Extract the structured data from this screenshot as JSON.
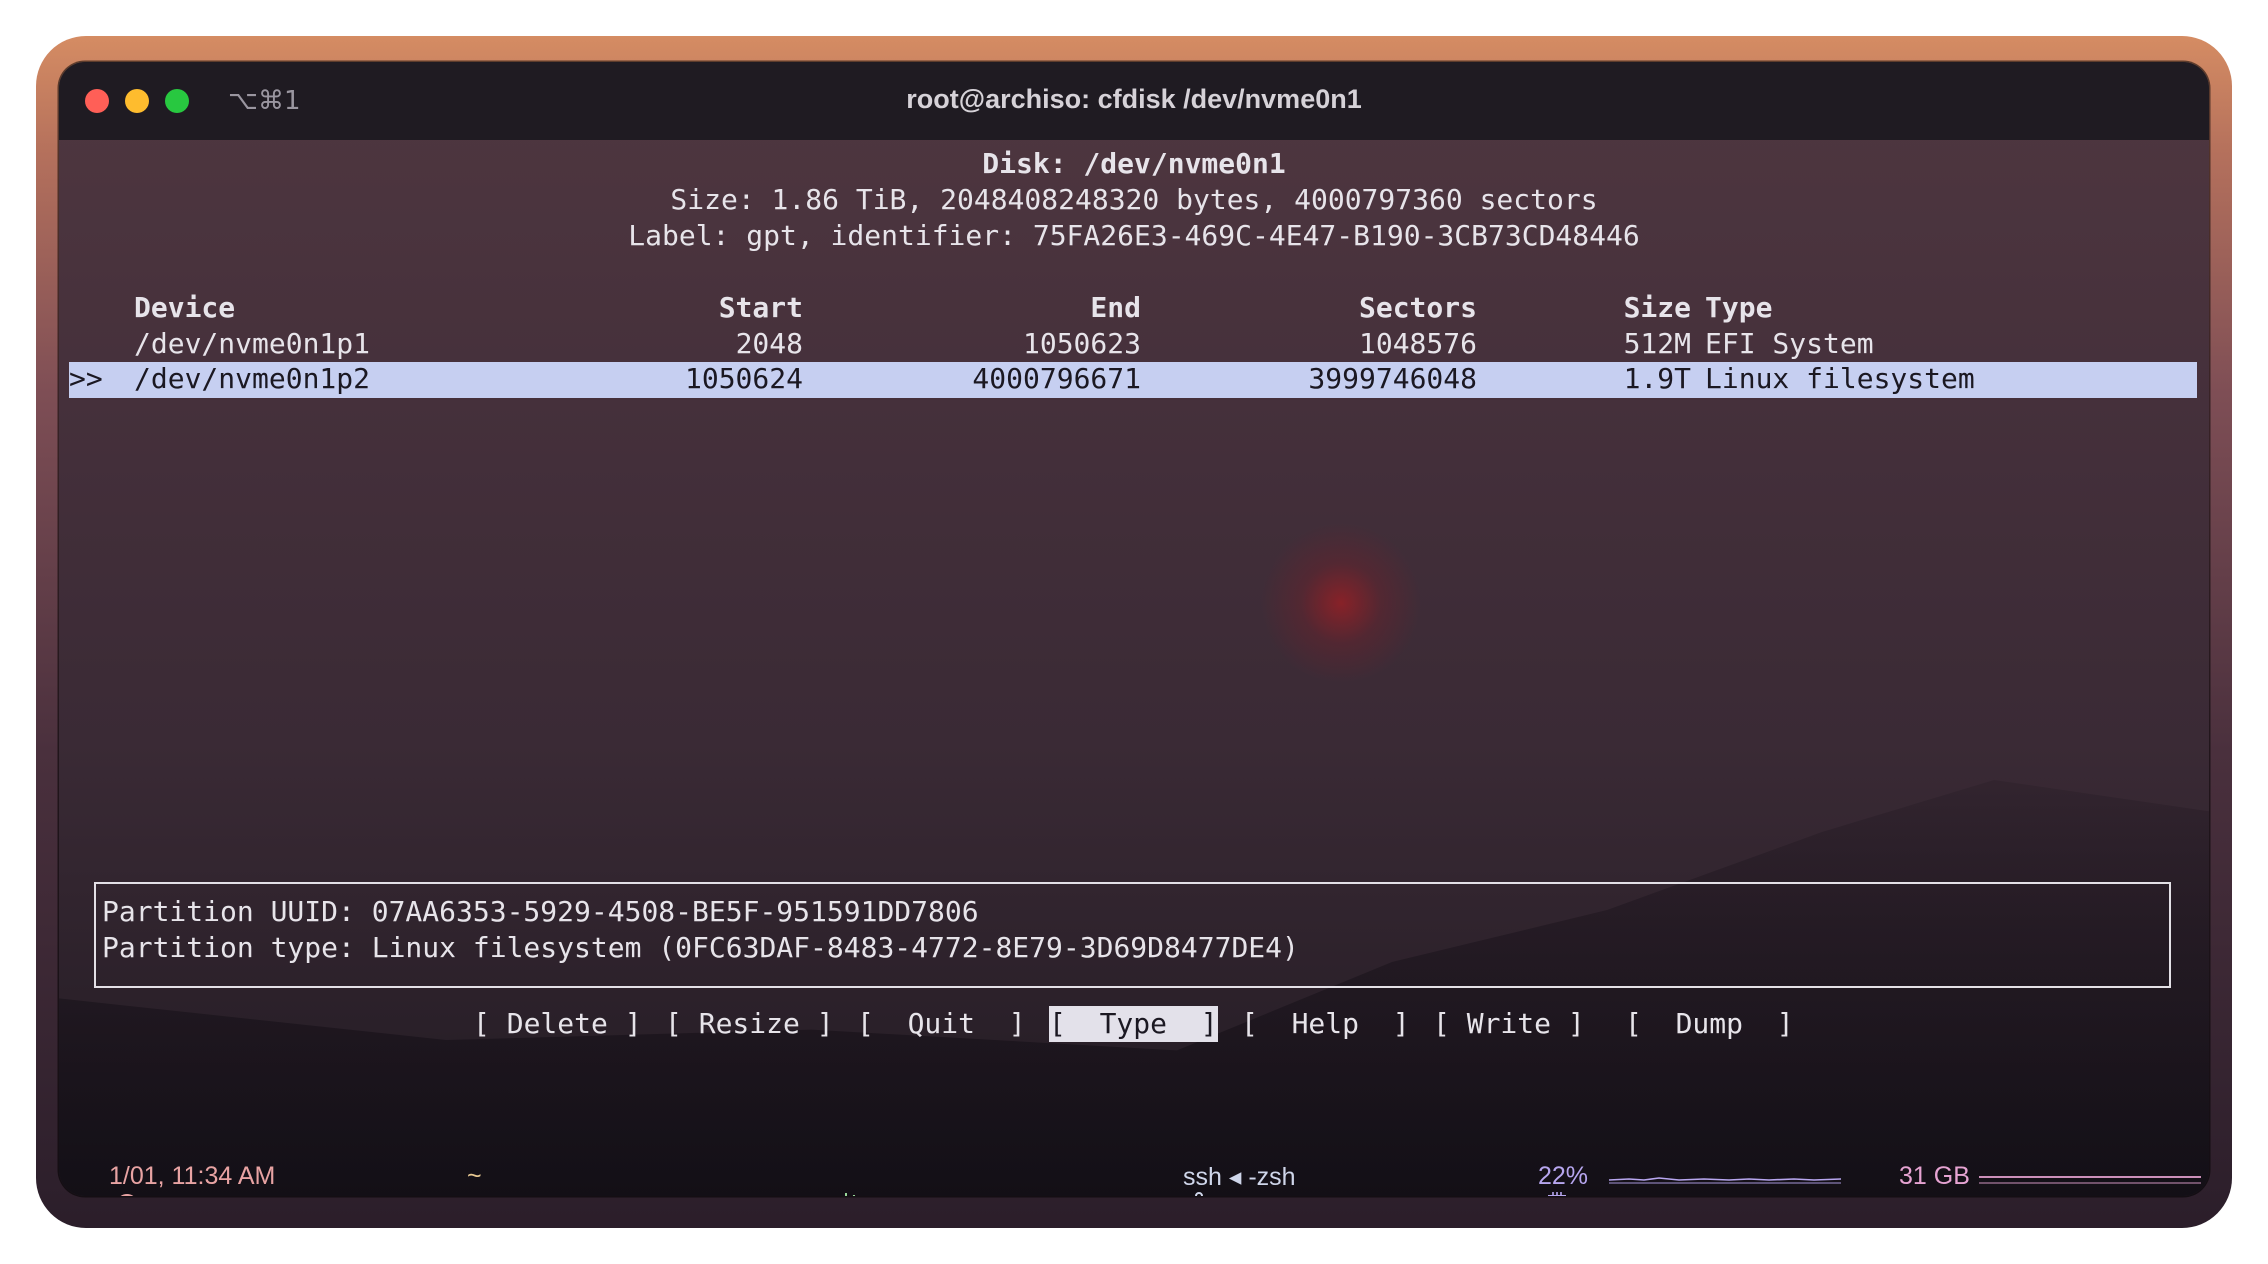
{
  "window": {
    "title": "root@archiso: cfdisk /dev/nvme0n1",
    "shortcut": "⌥⌘1"
  },
  "disk": {
    "header": "Disk: /dev/nvme0n1",
    "size_line": "Size: 1.86 TiB, 2048408248320 bytes, 4000797360 sectors",
    "label_line": "Label: gpt, identifier: 75FA26E3-469C-4E47-B190-3CB73CD48446"
  },
  "table": {
    "columns": {
      "device": "Device",
      "start": "Start",
      "end": "End",
      "sectors": "Sectors",
      "size": "Size",
      "type": "Type"
    },
    "rows": [
      {
        "marker": "",
        "device": "/dev/nvme0n1p1",
        "start": "2048",
        "end": "1050623",
        "sectors": "1048576",
        "size": "512M",
        "type": "EFI System",
        "selected": false
      },
      {
        "marker": ">>",
        "device": "/dev/nvme0n1p2",
        "start": "1050624",
        "end": "4000796671",
        "sectors": "3999746048",
        "size": "1.9T",
        "type": "Linux filesystem",
        "selected": true
      }
    ]
  },
  "info": {
    "uuid_line": "Partition UUID: 07AA6353-5929-4508-BE5F-951591DD7806",
    "type_line": "Partition type: Linux filesystem (0FC63DAF-8483-4772-8E79-3D69D8477DE4)"
  },
  "menu": {
    "delete": "[ Delete ]",
    "resize": "[ Resize ]",
    "quit": "[  Quit  ]",
    "type": "[  Type  ]",
    "help": "[  Help  ]",
    "write": "[ Write ]",
    "dump": "[  Dump  ]",
    "selected": "type"
  },
  "status": {
    "datetime": "1/01, 11:34 AM",
    "dir": "~",
    "process": "ssh ◂ -zsh",
    "cpu": "22%",
    "memory": "31 GB"
  },
  "colors": {
    "selection_bg": "#c6cff1",
    "menu_selected_bg": "#e3e1ea",
    "clock": "#e8a3a3",
    "folder": "#e8c992",
    "git": "#9ad89a",
    "cpu": "#b7a6ef",
    "memory": "#e6a3d2"
  }
}
